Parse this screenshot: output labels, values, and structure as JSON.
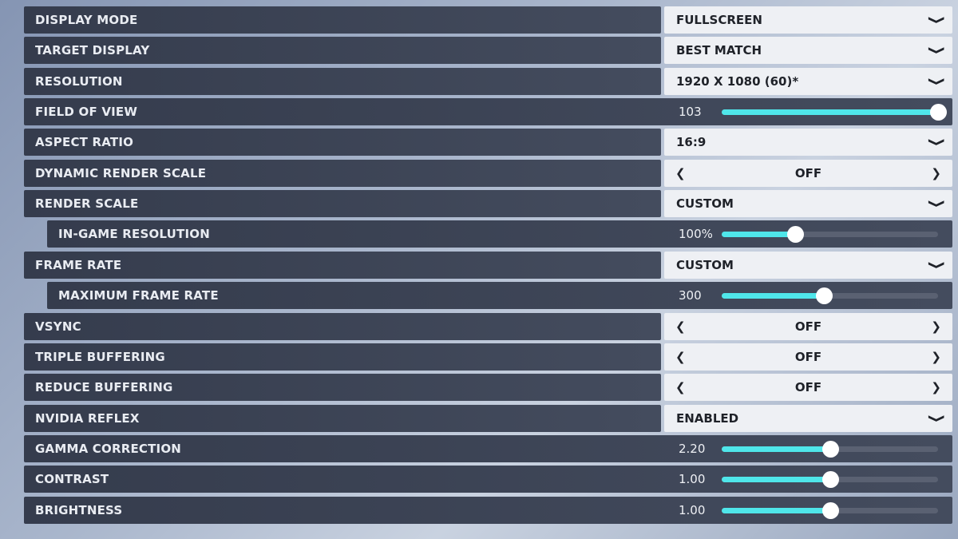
{
  "settings": [
    {
      "label": "DISPLAY MODE",
      "type": "dropdown",
      "value": "FULLSCREEN"
    },
    {
      "label": "TARGET DISPLAY",
      "type": "dropdown",
      "value": "BEST MATCH"
    },
    {
      "label": "RESOLUTION",
      "type": "dropdown",
      "value": "1920 X 1080 (60)*"
    },
    {
      "label": "FIELD OF VIEW",
      "type": "slider",
      "value": "103",
      "fill": 1.0
    },
    {
      "label": "ASPECT RATIO",
      "type": "dropdown",
      "value": "16:9"
    },
    {
      "label": "DYNAMIC RENDER SCALE",
      "type": "toggle",
      "value": "OFF"
    },
    {
      "label": "RENDER SCALE",
      "type": "dropdown",
      "value": "CUSTOM"
    },
    {
      "label": "IN-GAME RESOLUTION",
      "type": "slider",
      "value": "100%",
      "fill": 0.34,
      "sub": true
    },
    {
      "label": "FRAME RATE",
      "type": "dropdown",
      "value": "CUSTOM"
    },
    {
      "label": "MAXIMUM FRAME RATE",
      "type": "slider",
      "value": "300",
      "fill": 0.473,
      "sub": true
    },
    {
      "label": "VSYNC",
      "type": "toggle",
      "value": "OFF"
    },
    {
      "label": "TRIPLE BUFFERING",
      "type": "toggle",
      "value": "OFF"
    },
    {
      "label": "REDUCE BUFFERING",
      "type": "toggle",
      "value": "OFF"
    },
    {
      "label": "NVIDIA REFLEX",
      "type": "dropdown",
      "value": "ENABLED"
    },
    {
      "label": "GAMMA CORRECTION",
      "type": "slider",
      "value": "2.20",
      "fill": 0.5
    },
    {
      "label": "CONTRAST",
      "type": "slider",
      "value": "1.00",
      "fill": 0.5
    },
    {
      "label": "BRIGHTNESS",
      "type": "slider",
      "value": "1.00",
      "fill": 0.5
    }
  ],
  "icons": {
    "dropdown": "chevron-down-icon",
    "left": "chevron-left-icon",
    "right": "chevron-right-icon"
  },
  "colors": {
    "accent": "#4fe6ea",
    "row": "#3b4254",
    "control": "#eef0f4"
  }
}
